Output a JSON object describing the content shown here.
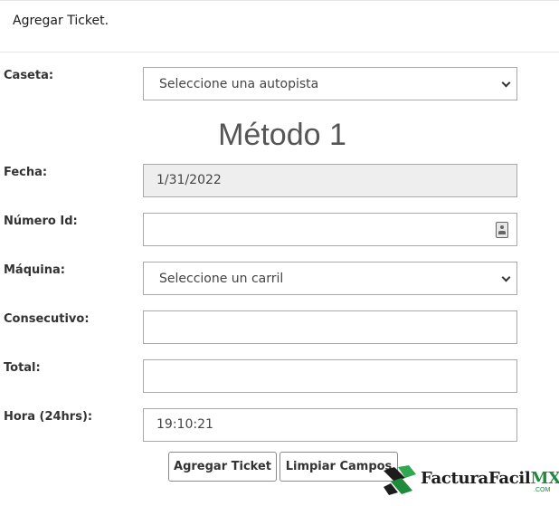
{
  "header": {
    "title": "Agregar Ticket."
  },
  "form": {
    "method_title": "Método 1",
    "caseta": {
      "label": "Caseta:",
      "value": "Seleccione una autopista"
    },
    "fecha": {
      "label": "Fecha:",
      "value": "1/31/2022"
    },
    "numero_id": {
      "label": "Número Id:",
      "value": ""
    },
    "maquina": {
      "label": "Máquina:",
      "value": "Seleccione un carril"
    },
    "consecutivo": {
      "label": "Consecutivo:",
      "value": ""
    },
    "total": {
      "label": "Total:",
      "value": ""
    },
    "hora": {
      "label": "Hora (24hrs):",
      "value": "19:10:21"
    }
  },
  "buttons": {
    "add": "Agregar Ticket",
    "clear": "Limpiar Campos"
  },
  "logo": {
    "name": "FacturaFacil",
    "suffix": "MX",
    "domain": ".COM",
    "brand_color": "#1f8a3a"
  }
}
